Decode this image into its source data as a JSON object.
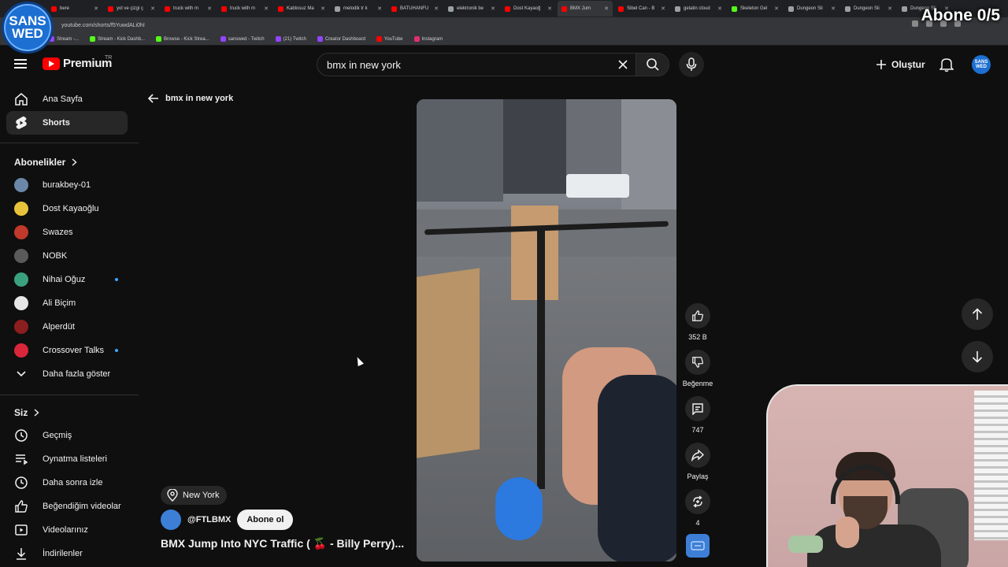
{
  "browser": {
    "tabs": [
      {
        "label": "bere",
        "color": "#ff0000"
      },
      {
        "label": "yol ve çizgi ç",
        "color": "#ff0000"
      },
      {
        "label": "truck with m",
        "color": "#ff0000"
      },
      {
        "label": "truck with m",
        "color": "#ff0000"
      },
      {
        "label": "Kablosuz Ma",
        "color": "#ff0000"
      },
      {
        "label": "melodik tr k",
        "color": "#9aa0a6"
      },
      {
        "label": "BATUHANFU",
        "color": "#ff0000"
      },
      {
        "label": "elektronik be",
        "color": "#9aa0a6"
      },
      {
        "label": "Dost Kayaoğ",
        "color": "#ff0000"
      },
      {
        "label": "BMX Jum",
        "color": "#ff0000"
      },
      {
        "label": "Sibel Can - B",
        "color": "#ff0000"
      },
      {
        "label": "gelatin cloud",
        "color": "#9aa0a6"
      },
      {
        "label": "Skeleton Gel",
        "color": "#53fc18"
      },
      {
        "label": "Dungeon Sli",
        "color": "#9aa0a6"
      },
      {
        "label": "Dungeon Sli",
        "color": "#9aa0a6"
      },
      {
        "label": "Dungeon Sli",
        "color": "#9aa0a6"
      }
    ],
    "url": "youtube.com/shorts/f5YuwdALi0hI",
    "bookmarks": [
      {
        "label": "Stream -...",
        "color": "#9146ff"
      },
      {
        "label": "Stream - Kick Dashb...",
        "color": "#53fc18"
      },
      {
        "label": "Browse - Kick Strea...",
        "color": "#53fc18"
      },
      {
        "label": "sanswed - Twitch",
        "color": "#9146ff"
      },
      {
        "label": "(21) Twitch",
        "color": "#9146ff"
      },
      {
        "label": "Creator Dashboard",
        "color": "#9146ff"
      },
      {
        "label": "YouTube",
        "color": "#ff0000"
      },
      {
        "label": "Instagram",
        "color": "#e1306c"
      }
    ]
  },
  "overlay": {
    "badge_line1": "SANS",
    "badge_line2": "WED",
    "subscriber_goal": "Abone 0/5"
  },
  "header": {
    "logo": "Premium",
    "country": "TR",
    "search_value": "bmx in new york",
    "create_label": "Oluştur",
    "avatar_text": "SANS WED"
  },
  "sidebar": {
    "main": [
      {
        "label": "Ana Sayfa",
        "icon": "home-icon"
      },
      {
        "label": "Shorts",
        "icon": "shorts-icon"
      }
    ],
    "subscriptions_title": "Abonelikler",
    "subscriptions": [
      {
        "label": "burakbey-01",
        "color": "#6b87a8",
        "live": false
      },
      {
        "label": "Dost Kayaoğlu",
        "color": "#e8c23a",
        "live": false
      },
      {
        "label": "Swazes",
        "color": "#c0392b",
        "live": false
      },
      {
        "label": "NOBK",
        "color": "#5a5a5a",
        "live": false
      },
      {
        "label": "Nihai Oğuz",
        "color": "#3aa17e",
        "live": true
      },
      {
        "label": "Ali Biçim",
        "color": "#e6e6e6",
        "live": false
      },
      {
        "label": "Alperdüt",
        "color": "#8b1e1e",
        "live": false
      },
      {
        "label": "Crossover Talks",
        "color": "#d9263b",
        "live": true
      }
    ],
    "show_more": "Daha fazla göster",
    "you_title": "Siz",
    "you_items": [
      {
        "label": "Geçmiş",
        "icon": "history-icon"
      },
      {
        "label": "Oynatma listeleri",
        "icon": "playlists-icon"
      },
      {
        "label": "Daha sonra izle",
        "icon": "watch-later-icon"
      },
      {
        "label": "Beğendiğim videolar",
        "icon": "liked-icon"
      },
      {
        "label": "Videolarınız",
        "icon": "your-videos-icon"
      },
      {
        "label": "İndirilenler",
        "icon": "downloads-icon"
      }
    ]
  },
  "main": {
    "back_label": "bmx in new york",
    "location": "New York",
    "channel": "@FTLBMX",
    "subscribe": "Abone ol",
    "title": "BMX Jump Into NYC Traffic ( 🍒 - Billy Perry)..."
  },
  "actions": {
    "likes": "352 B",
    "dislike": "Beğenme",
    "comments": "747",
    "share": "Paylaş",
    "remix": "4"
  }
}
